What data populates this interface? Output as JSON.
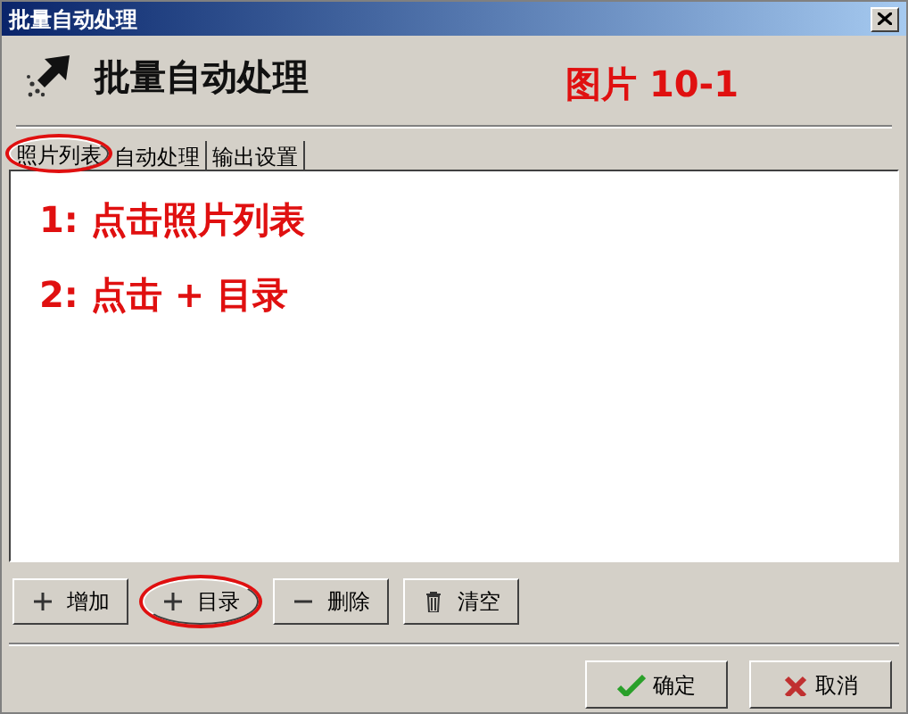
{
  "window": {
    "title": "批量自动处理"
  },
  "header": {
    "title": "批量自动处理",
    "annotation": "图片 10-1"
  },
  "tabs": [
    {
      "label": "照片列表",
      "selected": true,
      "circled": true
    },
    {
      "label": "自动处理",
      "selected": false,
      "circled": false
    },
    {
      "label": "输出设置",
      "selected": false,
      "circled": false
    }
  ],
  "notes": [
    "1: 点击照片列表",
    "2: 点击 + 目录"
  ],
  "list_buttons": [
    {
      "label": "增加",
      "kind": "add",
      "circled": false
    },
    {
      "label": "目录",
      "kind": "add",
      "circled": true
    },
    {
      "label": "删除",
      "kind": "remove",
      "circled": false
    },
    {
      "label": "清空",
      "kind": "clear",
      "circled": false
    }
  ],
  "dialog_buttons": [
    {
      "label": "确定",
      "kind": "confirm"
    },
    {
      "label": "取消",
      "kind": "cancel"
    }
  ]
}
